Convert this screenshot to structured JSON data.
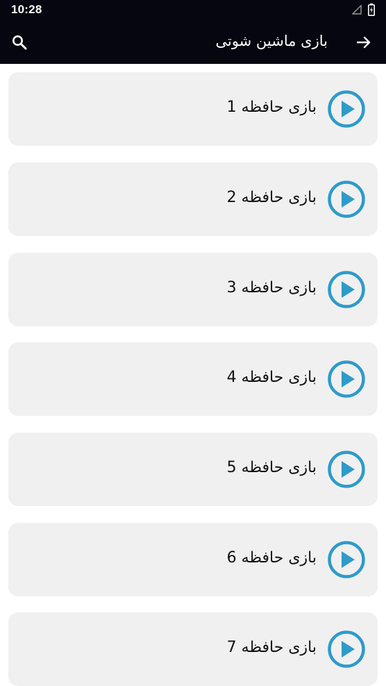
{
  "status_bar": {
    "time": "10:28"
  },
  "app_bar": {
    "title": "بازی ماشین شوتی",
    "search_icon": "search-icon",
    "back_icon": "arrow-right-icon"
  },
  "colors": {
    "bar_background": "#05060f",
    "card_background": "#f0f0f0",
    "accent_play": "#2e9bc9"
  },
  "items": [
    {
      "label": "بازی حافظه 1",
      "icon": "play-circle-icon"
    },
    {
      "label": "بازی حافظه 2",
      "icon": "play-circle-icon"
    },
    {
      "label": "بازی حافظه 3",
      "icon": "play-circle-icon"
    },
    {
      "label": "بازی حافظه 4",
      "icon": "play-circle-icon"
    },
    {
      "label": "بازی حافظه 5",
      "icon": "play-circle-icon"
    },
    {
      "label": "بازی حافظه 6",
      "icon": "play-circle-icon"
    },
    {
      "label": "بازی حافظه 7",
      "icon": "play-circle-icon"
    }
  ]
}
